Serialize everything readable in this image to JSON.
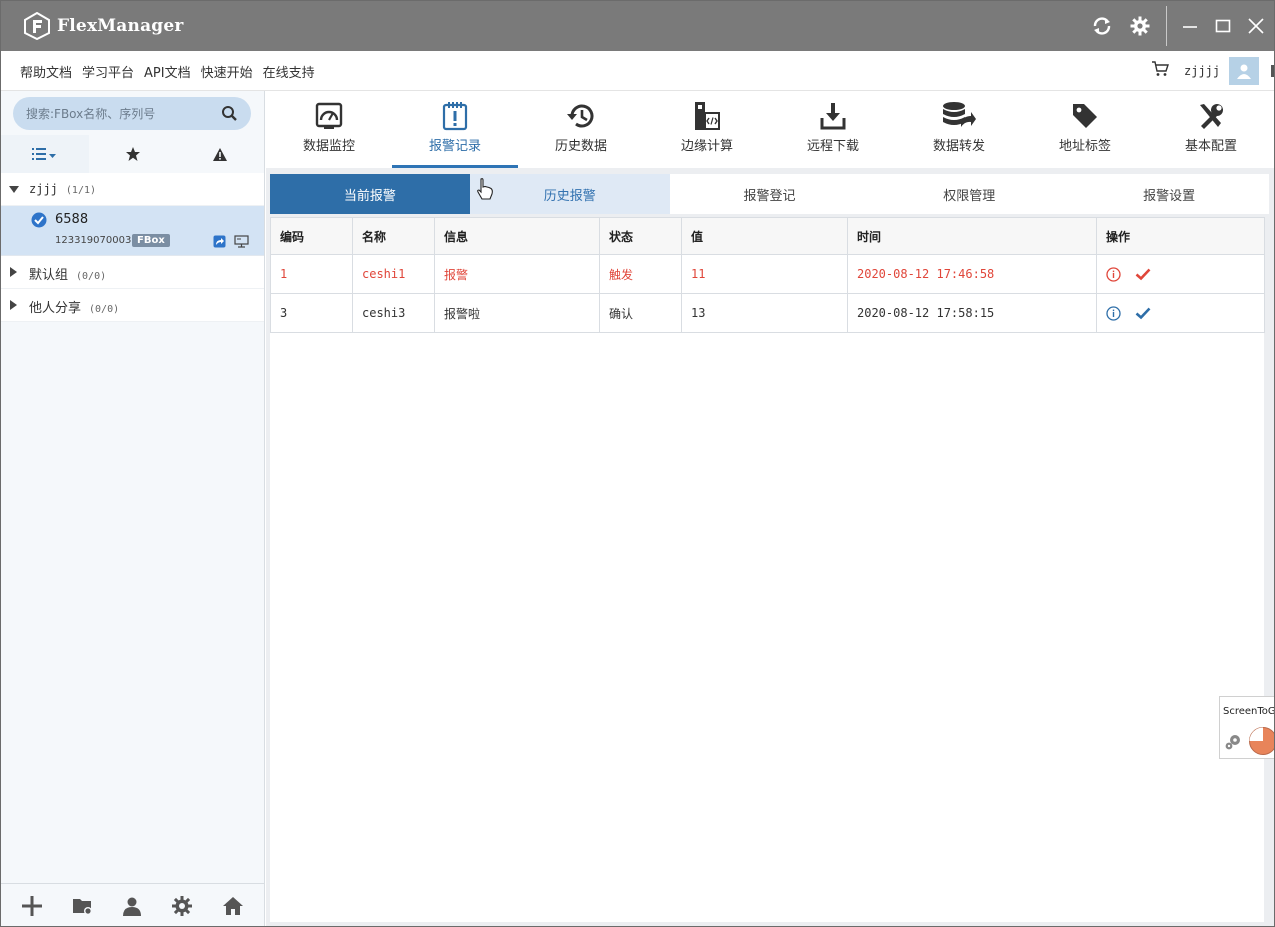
{
  "window": {
    "title": "FlexManager"
  },
  "menubar": {
    "links": [
      "帮助文档",
      "学习平台",
      "API文档",
      "快速开始",
      "在线支持"
    ],
    "username": "zjjjj"
  },
  "sidebar": {
    "search_placeholder": "搜索:FBox名称、序列号",
    "groups": [
      {
        "name": "zjjj",
        "count": "(1/1)",
        "expanded": true
      },
      {
        "name": "默认组",
        "count": "(0/0)",
        "expanded": false
      },
      {
        "name": "他人分享",
        "count": "(0/0)",
        "expanded": false
      }
    ],
    "device": {
      "name": "6588",
      "serial": "123319070003",
      "badge": "FBox"
    }
  },
  "toolbar": {
    "items": [
      "数据监控",
      "报警记录",
      "历史数据",
      "边缘计算",
      "远程下载",
      "数据转发",
      "地址标签",
      "基本配置"
    ],
    "active": "报警记录"
  },
  "subtabs": {
    "items": [
      "当前报警",
      "历史报警",
      "报警登记",
      "权限管理",
      "报警设置"
    ],
    "active": "当前报警"
  },
  "alarm_table": {
    "columns": [
      "编码",
      "名称",
      "信息",
      "状态",
      "值",
      "时间",
      "操作"
    ],
    "rows": [
      {
        "code": "1",
        "name": "ceshi1",
        "info": "报警",
        "status": "触发",
        "value": "11",
        "time": "2020-08-12 17:46:58"
      },
      {
        "code": "3",
        "name": "ceshi3",
        "info": "报警啦",
        "status": "确认",
        "value": "13",
        "time": "2020-08-12 17:58:15"
      }
    ]
  },
  "overlay": {
    "label": "ScreenToGi"
  },
  "colors": {
    "titlebar": "#7a7a7a",
    "accent": "#2e6ea8",
    "alarm_red": "#e0463a",
    "sidebar_bg": "#f5f8fb"
  }
}
